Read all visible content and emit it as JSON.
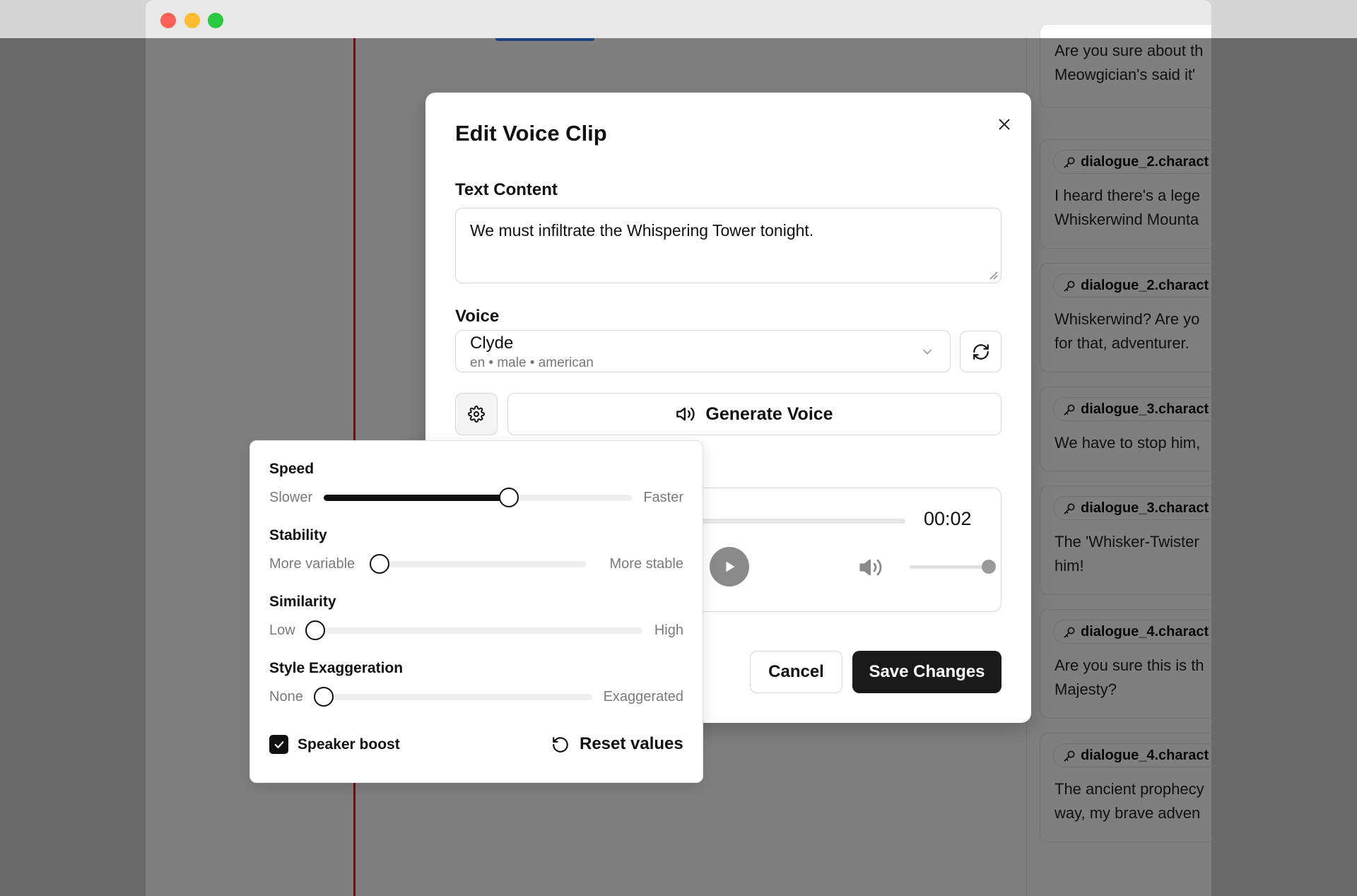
{
  "dialog": {
    "title": "Edit Voice Clip",
    "text_label": "Text Content",
    "text_value": "We must infiltrate the Whispering Tower tonight.",
    "voice_label": "Voice",
    "voice": {
      "name": "Clyde",
      "meta": "en • male • american"
    },
    "generate_label": "Generate Voice",
    "player": {
      "time": "00:02",
      "progress": 0.0,
      "volume": 1.0
    },
    "cancel_label": "Cancel",
    "save_label": "Save Changes"
  },
  "settings": {
    "speed": {
      "title": "Speed",
      "low": "Slower",
      "high": "Faster",
      "value": 0.6
    },
    "stability": {
      "title": "Stability",
      "low": "More variable",
      "high": "More stable",
      "value": 0.0
    },
    "similarity": {
      "title": "Similarity",
      "low": "Low",
      "high": "High",
      "value": 0.0
    },
    "style": {
      "title": "Style Exaggeration",
      "low": "None",
      "high": "Exaggerated",
      "value": 0.0
    },
    "speaker_boost_label": "Speaker boost",
    "speaker_boost": true,
    "reset_label": "Reset values"
  },
  "dialogue_list": {
    "items": [
      {
        "key": "",
        "text": "Are you sure about th\nMeowgician's said it'"
      },
      {
        "key": "dialogue_2.charact",
        "text": "I heard there's a lege\nWhiskerwind Mounta"
      },
      {
        "key": "dialogue_2.charact",
        "text": "Whiskerwind? Are yo\nfor that, adventurer."
      },
      {
        "key": "dialogue_3.charact",
        "text": "We have to stop him,"
      },
      {
        "key": "dialogue_3.charact",
        "text": "The 'Whisker-Twister\nhim!"
      },
      {
        "key": "dialogue_4.charact",
        "text": "Are you sure this is th\nMajesty?"
      },
      {
        "key": "dialogue_4.charact",
        "text": "The ancient prophecy\nway, my brave adven"
      }
    ]
  },
  "colors": {
    "playhead": "#e11d2a",
    "primary_button": "#1a1a1a",
    "overlay": "rgba(0,0,0,0.5)"
  }
}
